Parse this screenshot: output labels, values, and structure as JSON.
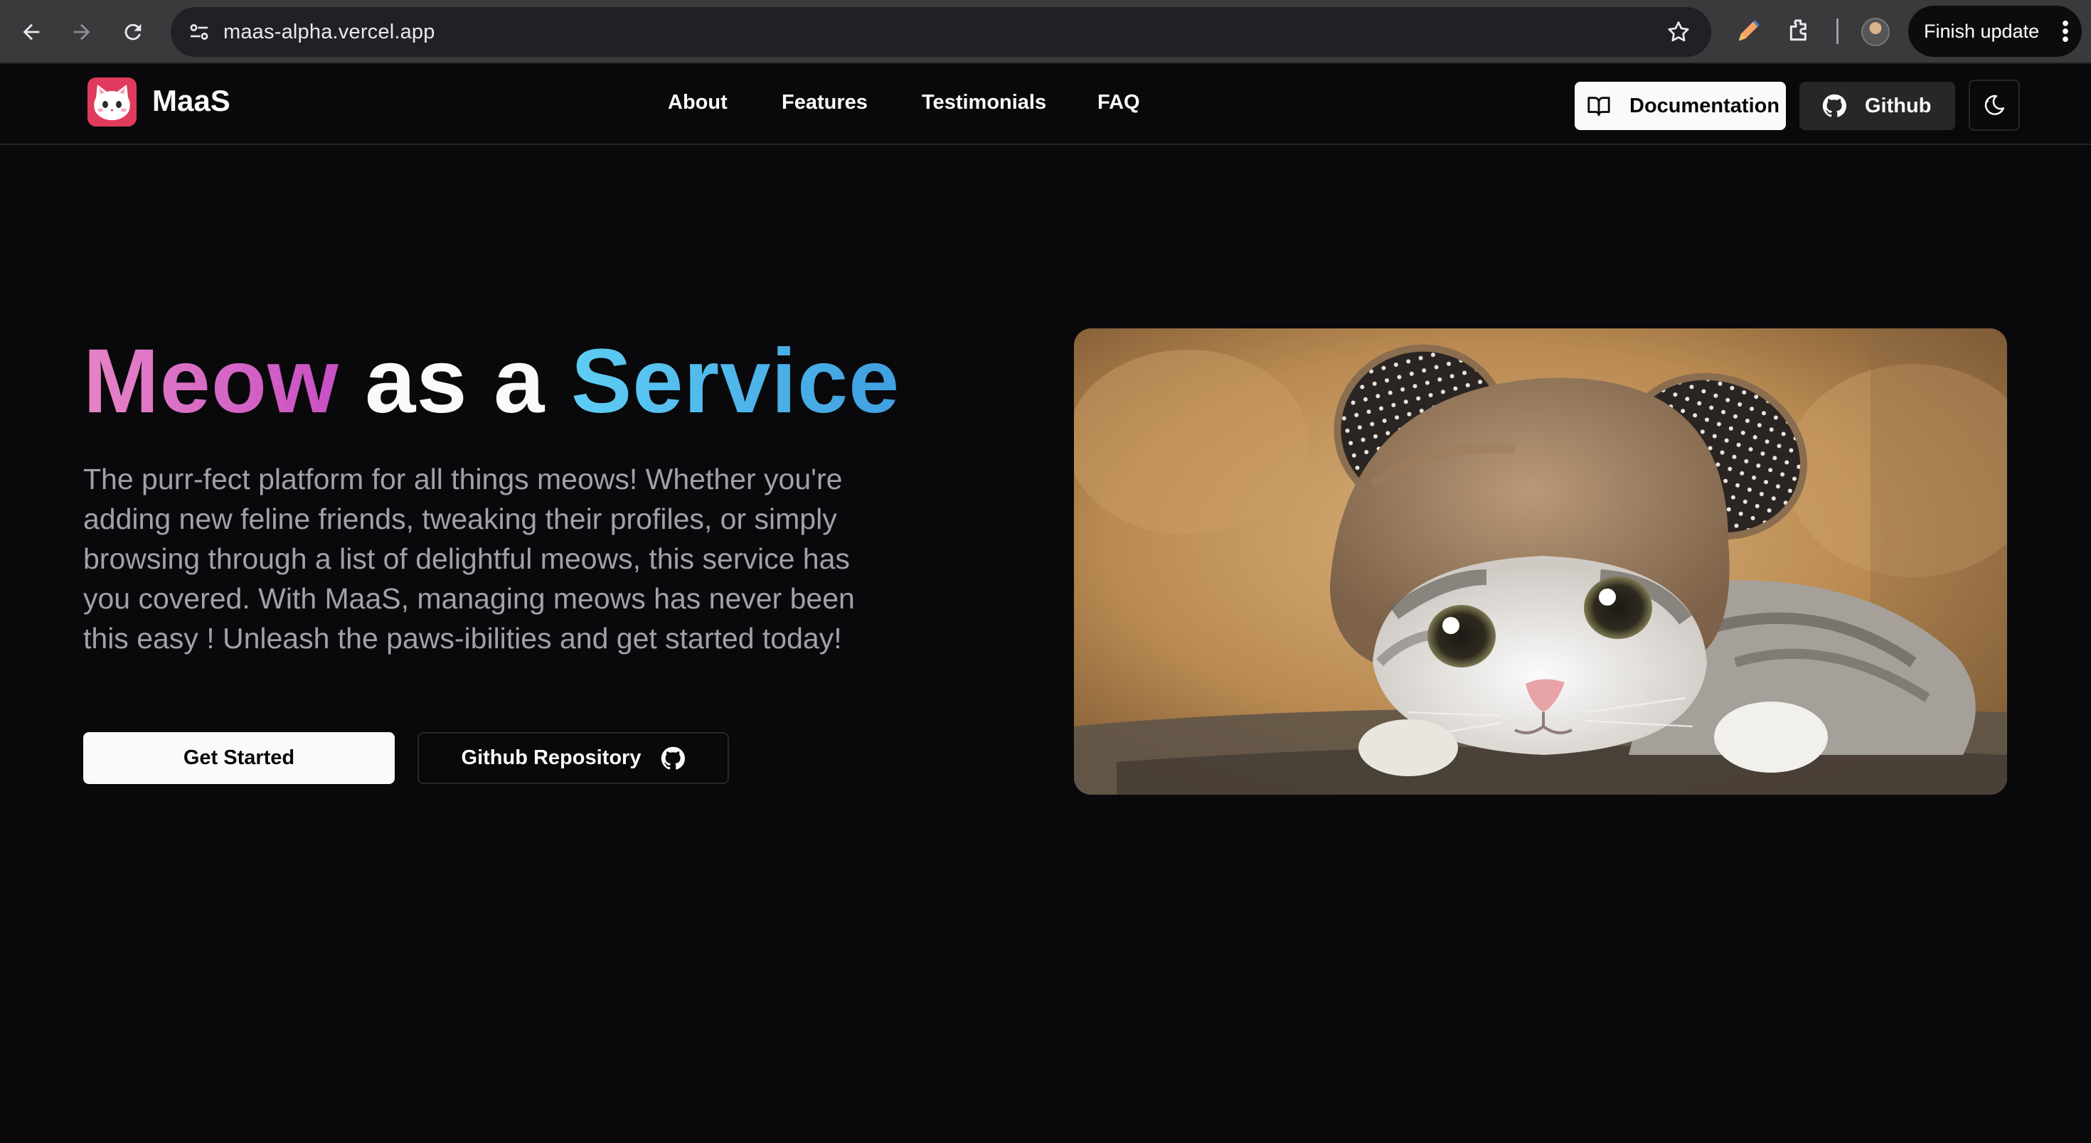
{
  "browser": {
    "url": "maas-alpha.vercel.app",
    "finish_update_label": "Finish update",
    "icons": [
      "back-arrow-icon",
      "forward-arrow-icon",
      "reload-icon",
      "site-settings-icon",
      "bookmark-star-icon",
      "pen-icon",
      "extensions-icon",
      "more-vert-icon"
    ]
  },
  "site": {
    "brand": "MaaS",
    "nav": {
      "links": [
        "About",
        "Features",
        "Testimonials",
        "FAQ"
      ],
      "documentation_label": "Documentation",
      "github_label": "Github"
    },
    "hero": {
      "title_part1": "Meow",
      "title_part2": "as a",
      "title_part3": "Service",
      "description": "The purr-fect platform for all things meows! Whether you're adding new feline friends, tweaking their profiles, or simply browsing through a list of delightful meows, this service has you covered. With MaaS, managing meows has never been this easy ! Unleash the paws-ibilities and get started today!",
      "primary_button": "Get Started",
      "secondary_button": "Github Repository"
    },
    "colors": {
      "background": "#09090b",
      "title_pink": "#d96bc6",
      "title_blue": "#4fb8ec",
      "muted_text": "#a1a1aa",
      "logo_red": "#e03b5c"
    }
  }
}
